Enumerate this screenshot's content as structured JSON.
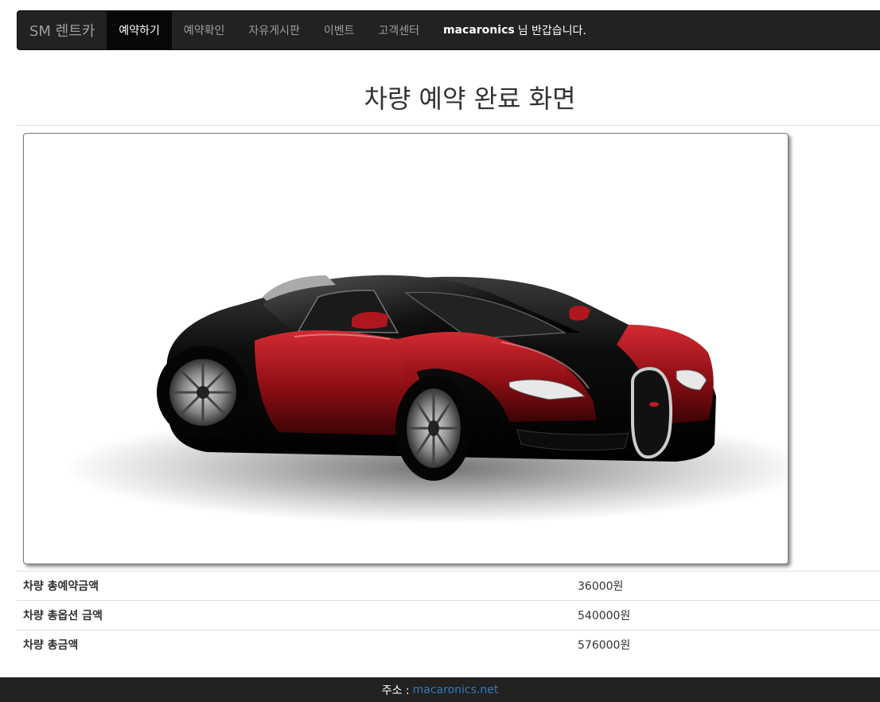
{
  "navbar": {
    "brand": "SM 렌트카",
    "items": [
      {
        "label": "예약하기",
        "active": true
      },
      {
        "label": "예약확인",
        "active": false
      },
      {
        "label": "자유게시판",
        "active": false
      },
      {
        "label": "이벤트",
        "active": false
      },
      {
        "label": "고객센터",
        "active": false
      }
    ],
    "user_name": "macaronics",
    "greeting_suffix": "님 반갑습니다."
  },
  "page": {
    "title": "차량 예약 완료 화면"
  },
  "car_image": {
    "icon": "sports-car-image",
    "colors": {
      "body_black": "#0a0a0a",
      "body_red": "#8b0e14",
      "accent_red": "#c21a22"
    }
  },
  "summary": {
    "rows": [
      {
        "label": "차량 총예약금액",
        "value": "36000원"
      },
      {
        "label": "차량 총옵션 금액",
        "value": "540000원"
      },
      {
        "label": "차량 총금액",
        "value": "576000원"
      }
    ]
  },
  "footer": {
    "address_label": "주소 :",
    "address_link": "macaronics.net"
  },
  "colors": {
    "navbar_bg": "#222222",
    "navbar_active_bg": "#080808",
    "nav_text": "#9d9d9d",
    "link": "#337ab7"
  }
}
